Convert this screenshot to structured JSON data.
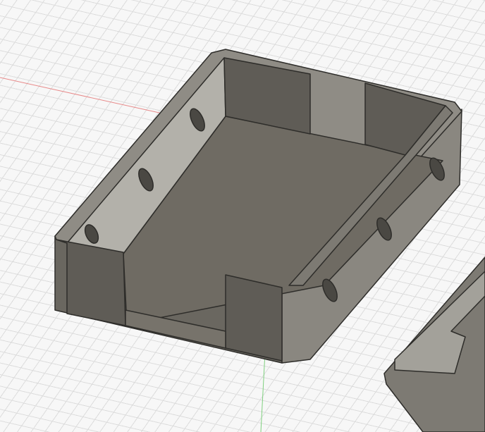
{
  "viewport": {
    "model": "enclosure-box",
    "colors": {
      "background": "#f7f7f7",
      "grid": "#dcdcdc",
      "x_axis": "#e88a8a",
      "y_axis": "#7fd07f",
      "body_light": "#a8a69f",
      "body_mid": "#7d7a73",
      "body_dark": "#5f5c56",
      "floor": "#6f6b63",
      "edge": "#2e2d2a"
    }
  }
}
